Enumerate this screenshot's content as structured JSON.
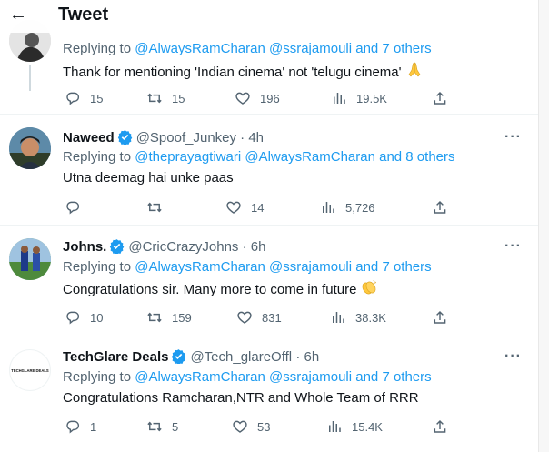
{
  "header": {
    "title": "Tweet"
  },
  "tweets": [
    {
      "name": "",
      "handle": "",
      "time": "",
      "reply_prefix": "Replying to",
      "reply_mentions": "@AlwaysRamCharan @ssrajamouli and 7 others",
      "text": "Thank for mentioning 'Indian cinema' not 'telugu cinema'",
      "emoji": "folded-hands",
      "counts": {
        "replies": "15",
        "retweets": "15",
        "likes": "196",
        "views": "19.5K"
      }
    },
    {
      "name": "Naweed",
      "handle": "@Spoof_Junkey",
      "time": "· 4h",
      "reply_prefix": "Replying to",
      "reply_mentions": "@theprayagtiwari @AlwaysRamCharan and 8 others",
      "text": "Utna deemag hai unke paas",
      "counts": {
        "replies": "",
        "retweets": "",
        "likes": "14",
        "views": "5,726"
      }
    },
    {
      "name": "Johns.",
      "handle": "@CricCrazyJohns",
      "time": "· 6h",
      "reply_prefix": "Replying to",
      "reply_mentions": "@AlwaysRamCharan @ssrajamouli and 7 others",
      "text": "Congratulations sir. Many more to come in future",
      "emoji": "clapping-hands",
      "counts": {
        "replies": "10",
        "retweets": "159",
        "likes": "831",
        "views": "38.3K"
      }
    },
    {
      "name": "TechGlare Deals",
      "handle": "@Tech_glareOffl",
      "time": "· 6h",
      "reply_prefix": "Replying to",
      "reply_mentions": "@AlwaysRamCharan @ssrajamouli and 7 others",
      "text": "Congratulations Ramcharan,NTR and Whole Team of RRR",
      "avatar_logo_text": "TECHGLARE DEALS",
      "counts": {
        "replies": "1",
        "retweets": "5",
        "likes": "53",
        "views": "15.4K"
      }
    }
  ],
  "colors": {
    "link": "#1d9bf0",
    "muted": "#536471",
    "verified": "#1d9bf0"
  },
  "icons": [
    "back-arrow-icon",
    "verified-badge-icon",
    "more-icon",
    "reply-icon",
    "retweet-icon",
    "like-icon",
    "views-icon",
    "share-icon"
  ]
}
